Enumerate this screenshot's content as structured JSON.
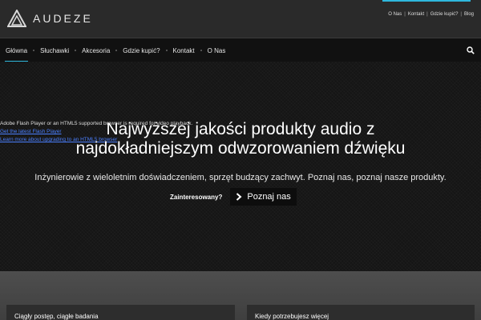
{
  "header": {
    "logo_text": "AUDEZE",
    "accent_color": "#2fb8dd",
    "top_links": [
      "O Nas",
      "Kontakt",
      "Gdzie kupić?",
      "Blog"
    ]
  },
  "nav": {
    "items": [
      "Główna",
      "Słuchawki",
      "Akcesoria",
      "Gdzie kupić?",
      "Kontakt",
      "O Nas"
    ],
    "active_index": 0,
    "search_icon": "search-icon"
  },
  "hero": {
    "flash_text": "Adobe Flash Player or an HTML5 supported browser is required for video playback.",
    "flash_link1": "Get the latest Flash Player",
    "flash_link2": "Learn more about upgrading to an HTML5 browser",
    "title_line1": "Najwyższej jakości produkty audio z",
    "title_line2": "najdokładniejszym odwzorowaniem dźwięku",
    "subtitle": "Inżynierowie z wieloletnim doświadczeniem, sprzęt budzący zachwyt. Poznaj nas, poznaj nasze produkty.",
    "cta_label": "Zainteresowany?",
    "cta_button": "Poznaj nas"
  },
  "cards": {
    "left_title": "Ciągły postęp, ciągłe badania",
    "right_title": "Kiedy potrzebujesz więcej"
  }
}
